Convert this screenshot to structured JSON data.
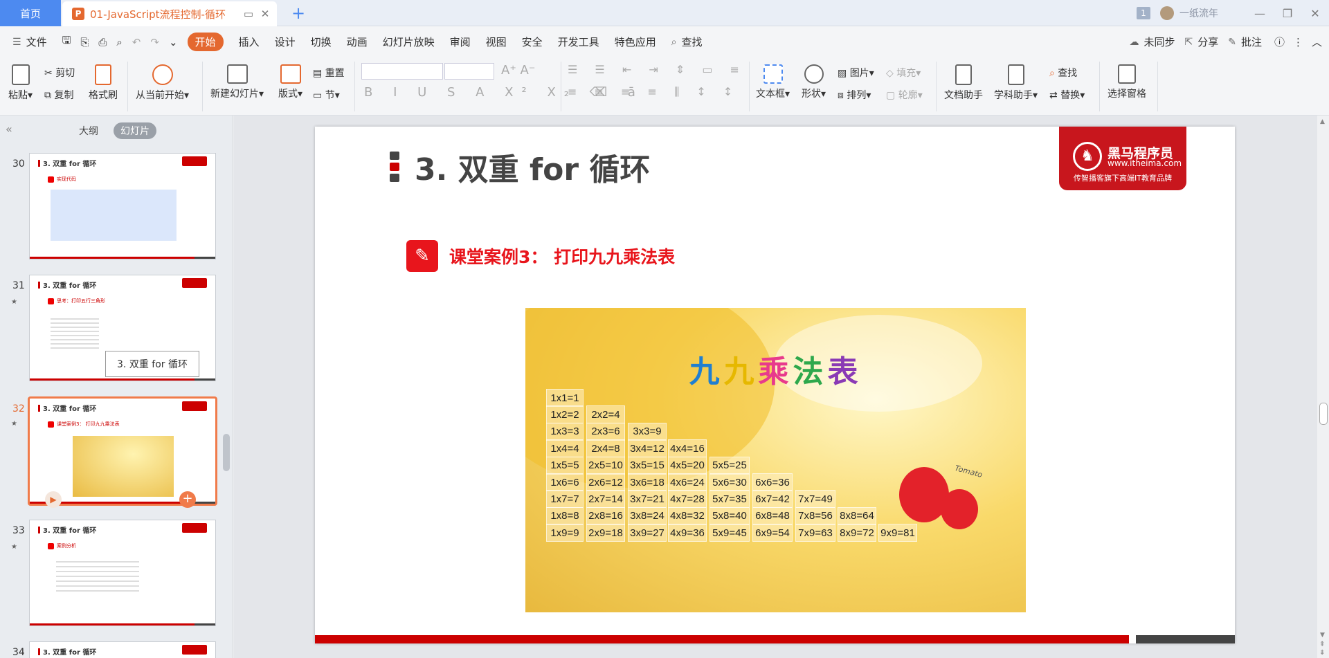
{
  "titlebar": {
    "home_tab": "首页",
    "doc_tab": "01-JavaScript流程控制-循环",
    "doc_icon": "P",
    "badge": "1",
    "user": "一纸流年"
  },
  "menu": {
    "file": "文件",
    "items": [
      "开始",
      "插入",
      "设计",
      "切换",
      "动画",
      "幻灯片放映",
      "审阅",
      "视图",
      "安全",
      "开发工具",
      "特色应用"
    ],
    "search": "查找",
    "sync": "未同步",
    "share": "分享",
    "comment": "批注"
  },
  "ribbon": {
    "paste": "粘贴",
    "cut": "剪切",
    "copy": "复制",
    "format_painter": "格式刷",
    "play_from_current": "从当前开始",
    "new_slide": "新建幻灯片",
    "layout": "版式",
    "reset": "重置",
    "section": "节",
    "textbox": "文本框",
    "shape": "形状",
    "picture": "图片",
    "arrange": "排列",
    "fill": "填充",
    "outline": "轮廓",
    "doc_assistant": "文档助手",
    "subject_assistant": "学科助手",
    "find": "查找",
    "replace": "替换",
    "selection_pane": "选择窗格"
  },
  "sidebar": {
    "tab_outline": "大纲",
    "tab_slides": "幻灯片",
    "thumbs": [
      {
        "num": "30",
        "title": "3. 双重 for 循环",
        "sub": "实现代码"
      },
      {
        "num": "31",
        "title": "3. 双重 for 循环",
        "sub": "思考：打印五行三角形"
      },
      {
        "num": "32",
        "title": "3. 双重 for 循环",
        "sub": "课堂案例3： 打印九九乘法表"
      },
      {
        "num": "33",
        "title": "3. 双重 for 循环",
        "sub": "案例分析"
      },
      {
        "num": "34",
        "title": "3. 双重 for 循环",
        "sub": ""
      }
    ],
    "tooltip": "3. 双重 for 循环"
  },
  "slide": {
    "title": "3. 双重 for 循环",
    "logo_name": "黑马程序员",
    "logo_url": "www.itheima.com",
    "logo_tagline": "传智播客旗下高端IT教育品牌",
    "case_title": "课堂案例3：  打印九九乘法表",
    "image_title_chars": [
      "九",
      "九",
      "乘",
      "法",
      "表"
    ],
    "image_title_colors": [
      "#1f7fd1",
      "#e6b800",
      "#e83a8c",
      "#2ea84c",
      "#8a3ab5"
    ],
    "tomato_label": "Tomato",
    "table": [
      [
        "1x1=1"
      ],
      [
        "1x2=2",
        "2x2=4"
      ],
      [
        "1x3=3",
        "2x3=6",
        "3x3=9"
      ],
      [
        "1x4=4",
        "2x4=8",
        "3x4=12",
        "4x4=16"
      ],
      [
        "1x5=5",
        "2x5=10",
        "3x5=15",
        "4x5=20",
        "5x5=25"
      ],
      [
        "1x6=6",
        "2x6=12",
        "3x6=18",
        "4x6=24",
        "5x6=30",
        "6x6=36"
      ],
      [
        "1x7=7",
        "2x7=14",
        "3x7=21",
        "4x7=28",
        "5x7=35",
        "6x7=42",
        "7x7=49"
      ],
      [
        "1x8=8",
        "2x8=16",
        "3x8=24",
        "4x8=32",
        "5x8=40",
        "6x8=48",
        "7x8=56",
        "8x8=64"
      ],
      [
        "1x9=9",
        "2x9=18",
        "3x9=27",
        "4x9=36",
        "5x9=45",
        "6x9=54",
        "7x9=63",
        "8x9=72",
        "9x9=81"
      ]
    ]
  },
  "colors": {
    "accent": "#e4682f",
    "brand_red": "#c8161d",
    "case_red": "#e8151c"
  }
}
